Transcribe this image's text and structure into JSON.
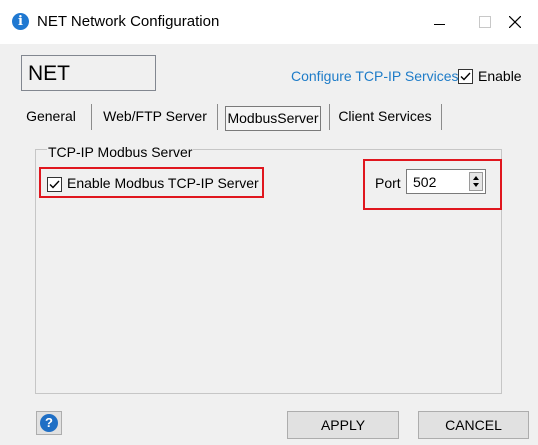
{
  "window": {
    "title": "NET Network Configuration",
    "icon": "info-icon"
  },
  "header": {
    "name_value": "NET",
    "configure_link": "Configure TCP-IP Services",
    "enable_label": "Enable",
    "enable_checked": true
  },
  "tabs": [
    {
      "label": "General",
      "active": false
    },
    {
      "label": "Web/FTP Server",
      "active": false
    },
    {
      "label": "ModbusServer",
      "active": true
    },
    {
      "label": "Client Services",
      "active": false
    }
  ],
  "modbus": {
    "group_title": "TCP-IP Modbus Server",
    "enable_label": "Enable Modbus TCP-IP Server",
    "enable_checked": true,
    "port_label": "Port",
    "port_value": "502"
  },
  "footer": {
    "apply_label": "APPLY",
    "cancel_label": "CANCEL",
    "help_icon": "?"
  },
  "colors": {
    "accent": "#1e7cc8",
    "highlight": "#e0161e"
  }
}
